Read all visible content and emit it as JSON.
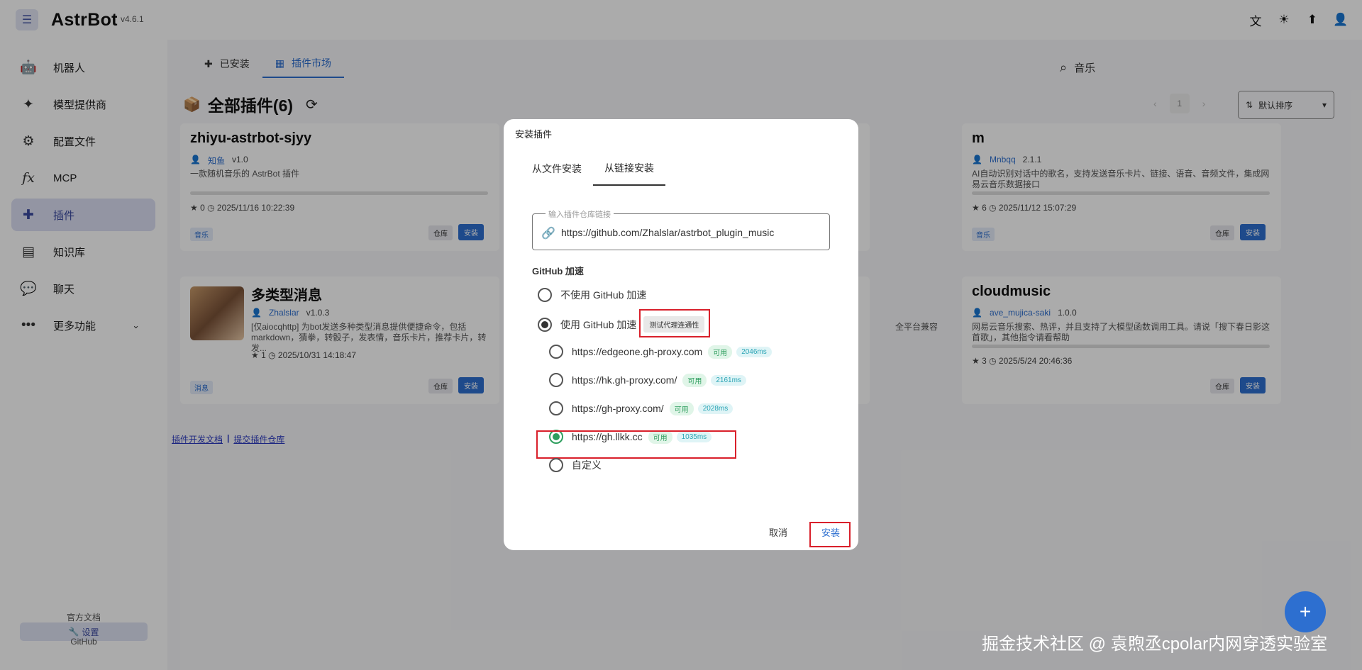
{
  "app": {
    "name": "AstrBot",
    "version": "v4.6.1"
  },
  "topbar": {
    "icons": [
      "translate-icon",
      "theme-icon",
      "upload-icon",
      "user-icon"
    ]
  },
  "sidebar": {
    "items": [
      {
        "label": "机器人",
        "icon": "robot-icon"
      },
      {
        "label": "模型提供商",
        "icon": "sparkle-icon"
      },
      {
        "label": "配置文件",
        "icon": "gear-icon"
      },
      {
        "label": "MCP",
        "icon": "function-icon"
      },
      {
        "label": "插件",
        "icon": "puzzle-icon",
        "active": true
      },
      {
        "label": "知识库",
        "icon": "book-icon"
      },
      {
        "label": "聊天",
        "icon": "chat-icon"
      },
      {
        "label": "更多功能",
        "icon": "more-icon"
      }
    ],
    "settings_label": "设置",
    "docs_label": "官方文档",
    "github_label": "GitHub"
  },
  "main": {
    "tabs": [
      {
        "label": "已安装"
      },
      {
        "label": "插件市场",
        "active": true
      }
    ],
    "search_value": "音乐",
    "section_title": "全部插件(6)",
    "page": "1",
    "sort_label": "默认排序",
    "cards": [
      {
        "title": "zhiyu-astrbot-sjyy",
        "author": "知鱼",
        "version": "v1.0",
        "desc": "一款随机音乐的 AstrBot 插件",
        "stars": "★ 0",
        "updated": "2025/11/16 10:22:39",
        "tag": "音乐",
        "repo_label": "仓库",
        "install_label": "安装"
      },
      {
        "title": "m",
        "author": "Mnbqq",
        "version": "2.1.1",
        "desc": "AI自动识别对话中的歌名，支持发送音乐卡片、链接、语音、音频文件，集成网易云音乐数据接口",
        "stars": "★ 6",
        "updated": "2025/11/12 15:07:29",
        "tag": "音乐",
        "repo_label": "仓库",
        "install_label": "安装"
      },
      {
        "title": "多类型消息",
        "author": "Zhalslar",
        "version": "v1.0.3",
        "desc": "[仅aiocqhttp] 为bot发送多种类型消息提供便捷命令，包括markdown，猜拳，转骰子，发表情，音乐卡片，推荐卡片，转发...",
        "stars": "★ 1",
        "updated": "2025/10/31 14:18:47",
        "tag": "消息",
        "repo_label": "仓库",
        "install_label": "安装"
      },
      {
        "title": "cloudmusic",
        "author": "ave_mujica-saki",
        "version": "1.0.0",
        "desc": "网易云音乐搜索、热评，并且支持了大模型函数调用工具。请说「搜下春日影这首歌」，其他指令请看帮助",
        "stars": "★ 3",
        "updated": "2025/5/24 20:46:36",
        "tag": "",
        "repo_label": "仓库",
        "install_label": "安装"
      }
    ],
    "partial_right": {
      "repo_label": "仓库",
      "install_label": "安装",
      "extra_desc": "全平台兼容"
    },
    "footer": {
      "dev_docs": "插件开发文档",
      "separator": "|",
      "submit_repo": "提交插件仓库"
    }
  },
  "dialog": {
    "title": "安装插件",
    "tabs": [
      {
        "label": "从文件安装"
      },
      {
        "label": "从链接安装",
        "active": true
      }
    ],
    "url_label": "输入插件仓库链接",
    "url_value": "https://github.com/Zhalslar/astrbot_plugin_music",
    "gh_accel_label": "GitHub 加速",
    "no_accel_label": "不使用 GitHub 加速",
    "use_accel_label": "使用 GitHub 加速",
    "test_proxy_label": "测试代理连通性",
    "proxies": [
      {
        "url": "https://edgeone.gh-proxy.com",
        "status": "可用",
        "latency": "2046ms"
      },
      {
        "url": "https://hk.gh-proxy.com/",
        "status": "可用",
        "latency": "2161ms"
      },
      {
        "url": "https://gh-proxy.com/",
        "status": "可用",
        "latency": "2028ms"
      },
      {
        "url": "https://gh.llkk.cc",
        "status": "可用",
        "latency": "1035ms",
        "selected": true
      }
    ],
    "custom_label": "自定义",
    "cancel_label": "取消",
    "install_label": "安装"
  },
  "fab_label": "+",
  "watermark": "掘金技术社区 @ 袁煦丞cpolar内网穿透实验室"
}
